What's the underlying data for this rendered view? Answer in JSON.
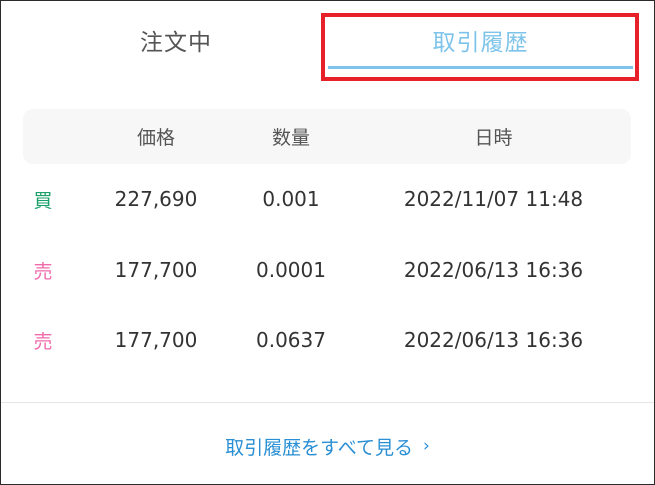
{
  "tabs": [
    {
      "label": "注文中"
    },
    {
      "label": "取引履歴"
    }
  ],
  "table": {
    "headers": [
      "価格",
      "数量",
      "日時"
    ],
    "rows": [
      {
        "side": "買",
        "side_color": "#1aa068",
        "price": "227,690",
        "quantity": "0.001",
        "datetime": "2022/11/07 11:48"
      },
      {
        "side": "売",
        "side_color": "#f06bab",
        "price": "177,700",
        "quantity": "0.0001",
        "datetime": "2022/06/13 16:36"
      },
      {
        "side": "売",
        "side_color": "#f06bab",
        "price": "177,700",
        "quantity": "0.0637",
        "datetime": "2022/06/13 16:36"
      }
    ]
  },
  "footer": {
    "view_all_label": "取引履歴をすべて見る",
    "chevron": "›"
  },
  "colors": {
    "active_tab": "#7ec4ea",
    "inactive_tab": "#555555",
    "buy": "#1aa068",
    "sell": "#f06bab",
    "link": "#2a8fd4",
    "highlight": "#e8202a"
  }
}
